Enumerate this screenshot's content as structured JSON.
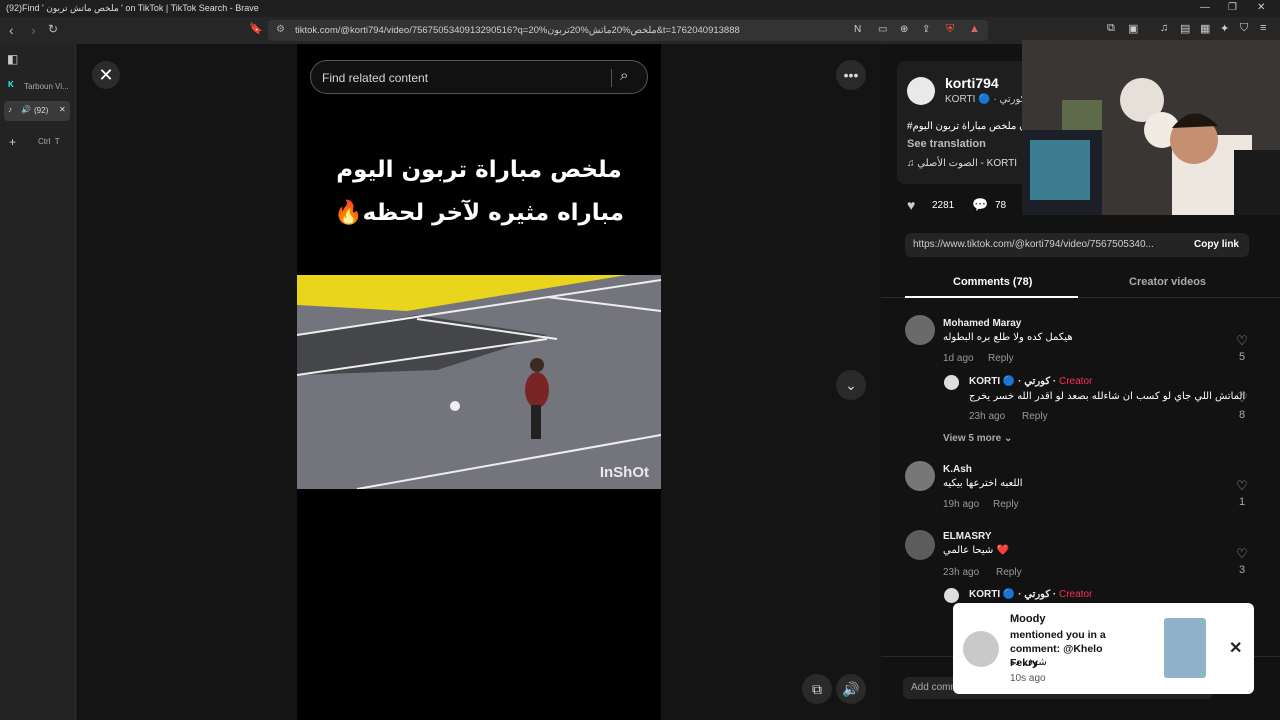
{
  "window": {
    "title": "(92)Find ' ملخص ماتش تربون ' on TikTok | TikTok Search - Brave"
  },
  "browser": {
    "url": "tiktok.com/@korti794/video/7567505340913290516?q=20%ملخص%20ماتش%20تربون&t=1762040913888",
    "tabs": [
      {
        "label": "Tarboun Vi..."
      },
      {
        "label": "(92)"
      }
    ],
    "new_tab_hint": "Ctrl  T"
  },
  "video": {
    "search_placeholder": "Find related content",
    "caption_line1": "ملخص مباراة تربون اليوم",
    "caption_line2": "مباراه مثيره لآخر لحظه🔥",
    "watermark": "InShOt"
  },
  "post": {
    "username": "korti794",
    "nickname": "KORTI 🔵 · كورتي",
    "description": "#تربون ملخص مباراة تربون اليوم",
    "see_translation": "See translation",
    "music": "♫  الصوت الأصلي - KORTI",
    "likes": "2281",
    "comments": "78",
    "link": "https://www.tiktok.com/@korti794/video/7567505340...",
    "copy_label": "Copy link"
  },
  "tabs": {
    "comments": "Comments (78)",
    "creator": "Creator videos"
  },
  "comments": [
    {
      "name": "Mohamed Maray",
      "text": "هيكمل كده ولا طلع بره البطوله",
      "time": "1d ago",
      "reply": "Reply",
      "likes": "5"
    },
    {
      "name": "KORTI 🔵 · كورتي",
      "badge": "Creator",
      "text": "الماتش اللي جاي لو كسب ان شاءلله بصعد لو اقدر الله خسر يخرج",
      "time": "23h ago",
      "reply": "Reply",
      "likes": "8"
    },
    {
      "name": "K.Ash",
      "text": "اللعبه اخترعها بيكيه",
      "time": "19h ago",
      "reply": "Reply",
      "likes": "1"
    },
    {
      "name": "ELMASRY",
      "text": "شيحا عالمي ❤️",
      "time": "23h ago",
      "reply": "Reply",
      "likes": "3"
    },
    {
      "name": "KORTI 🔵 · كورتي",
      "badge": "Creator"
    }
  ],
  "view_more": "View 5 more ⌄",
  "add_comment": "Add comment...",
  "notification": {
    "name": "Moody",
    "message": "mentioned you in a comment: @Khelo Fekry",
    "sub": "شوف ده",
    "time": "10s ago"
  },
  "colors": {
    "accent": "#fe2c55",
    "panel": "#121212",
    "stage": "#141414"
  }
}
